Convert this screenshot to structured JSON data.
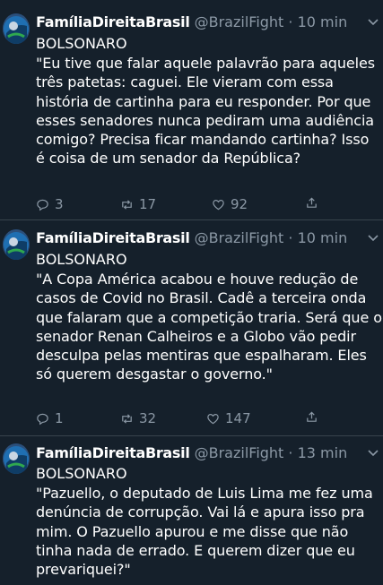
{
  "tweets": [
    {
      "display_name": "FamíliaDireitaBrasil",
      "handle": "@BrazilFight",
      "separator": "·",
      "time": "10 min",
      "author_line": "BOLSONARO",
      "text": "\"Eu tive que falar aquele palavrão para aqueles três patetas: caguei. Ele vieram com essa história de cartinha para eu responder. Por que esses senadores nunca pediram uma audiência comigo? Precisa ficar mandando cartinha? Isso é coisa de um senador da República?",
      "replies": "3",
      "retweets": "17",
      "likes": "92"
    },
    {
      "display_name": "FamíliaDireitaBrasil",
      "handle": "@BrazilFight",
      "separator": "·",
      "time": "10 min",
      "author_line": "BOLSONARO",
      "text": "\"A Copa América acabou e houve redução de casos de Covid no Brasil. Cadê a terceira onda que falaram que a competição traria. Será que o senador Renan Calheiros e a Globo vão pedir desculpa pelas mentiras que espalharam. Eles só querem desgastar o governo.\"",
      "replies": "1",
      "retweets": "32",
      "likes": "147"
    },
    {
      "display_name": "FamíliaDireitaBrasil",
      "handle": "@BrazilFight",
      "separator": "·",
      "time": "13 min",
      "author_line": "BOLSONARO",
      "text": "\"Pazuello, o deputado de Luis Lima me fez uma denúncia de corrupção. Vai lá e apura isso pra mim. O Pazuello apurou e me disse que não tinha nada de errado. E querem dizer que eu prevariquei?\"",
      "replies": "",
      "retweets": "",
      "likes": ""
    }
  ],
  "colors": {
    "background": "#15202b",
    "text": "#ffffff",
    "secondary": "#8b98a5",
    "divider": "#38444d"
  },
  "icons": [
    "avatar-image",
    "chevron-down-icon",
    "reply-icon",
    "retweet-icon",
    "like-icon",
    "share-icon"
  ]
}
